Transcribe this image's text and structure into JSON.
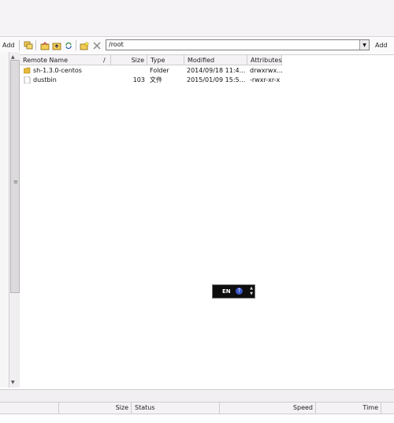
{
  "toolbar": {
    "add_left_label": "Add",
    "add_right_label": "Add",
    "path_value": "/root"
  },
  "filelist": {
    "columns": [
      "Remote Name",
      "/",
      "Size",
      "Type",
      "Modified",
      "Attributes"
    ],
    "rows": [
      {
        "name": "sh-1.3.0-centos",
        "size": "",
        "type": "Folder",
        "modified": "2014/09/18 11:4...",
        "attributes": "drwxrwx..."
      },
      {
        "name": "dustbin",
        "size": "103",
        "type": "文件",
        "modified": "2015/01/09 15:5...",
        "attributes": "-rwxr-xr-x"
      }
    ]
  },
  "language_bar": {
    "label": "EN",
    "help": "?"
  },
  "queue": {
    "columns": [
      "Size",
      "Status",
      "Speed",
      "Time"
    ]
  },
  "colors": {
    "folder": "#e8b93a",
    "accent": "#3a56c8"
  }
}
